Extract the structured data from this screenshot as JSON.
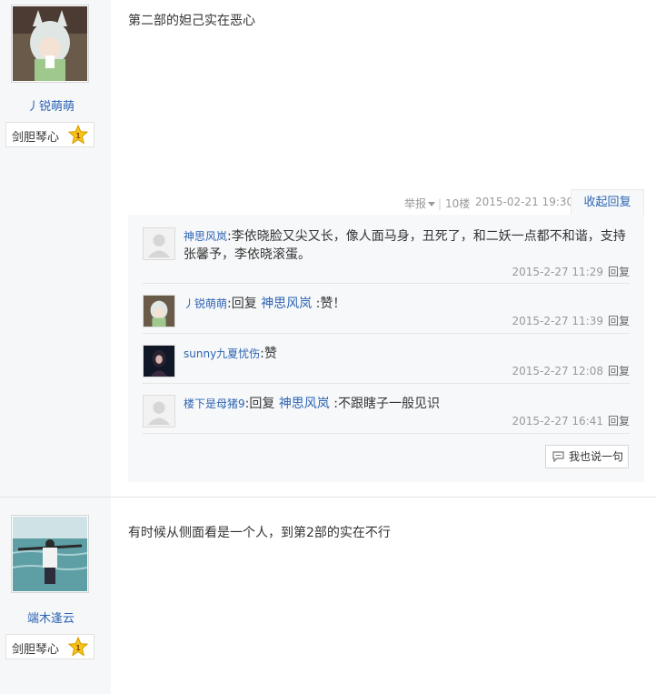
{
  "posts": [
    {
      "author": {
        "name": "丿锐萌萌",
        "badge_name": "剑胆琴心",
        "badge_level": "1"
      },
      "content": "第二部的妲己实在恶心",
      "tail": {
        "report": "举报",
        "floor": "10楼",
        "time": "2015-02-21 19:30",
        "collapse": "收起回复"
      },
      "replies": [
        {
          "user": "神思风岚",
          "text": "李依晓脸又尖又长，像人面马身，丑死了，和二妖一点都不和谐，支持张馨予，李依晓滚蛋。",
          "time": "2015-2-27 11:29",
          "reply_label": "回复"
        },
        {
          "user": "丿锐萌萌",
          "prefix": "回复",
          "ref_user": "神思风岚",
          "text": ":赞！",
          "time": "2015-2-27 11:39",
          "reply_label": "回复"
        },
        {
          "user": "sunny九夏忧伤",
          "text": "赞",
          "time": "2015-2-27 12:08",
          "reply_label": "回复"
        },
        {
          "user": "楼下是母猪9",
          "prefix": "回复",
          "ref_user": "神思风岚",
          "text": ":不跟瞎子一般见识",
          "time": "2015-2-27 16:41",
          "reply_label": "回复"
        }
      ],
      "say_button": "我也说一句"
    },
    {
      "author": {
        "name": "端木逢云",
        "badge_name": "剑胆琴心",
        "badge_level": "1"
      },
      "content": "有时候从侧面看是一个人，到第2部的实在不行"
    }
  ],
  "colors": {
    "link": "#2d64b3",
    "meta": "#999999",
    "panel": "#f7f8fa",
    "left_col": "#f6f7f9"
  },
  "icons": [
    "default-avatar-icon",
    "star-level-icon",
    "comment-icon",
    "dropdown-caret-icon"
  ]
}
